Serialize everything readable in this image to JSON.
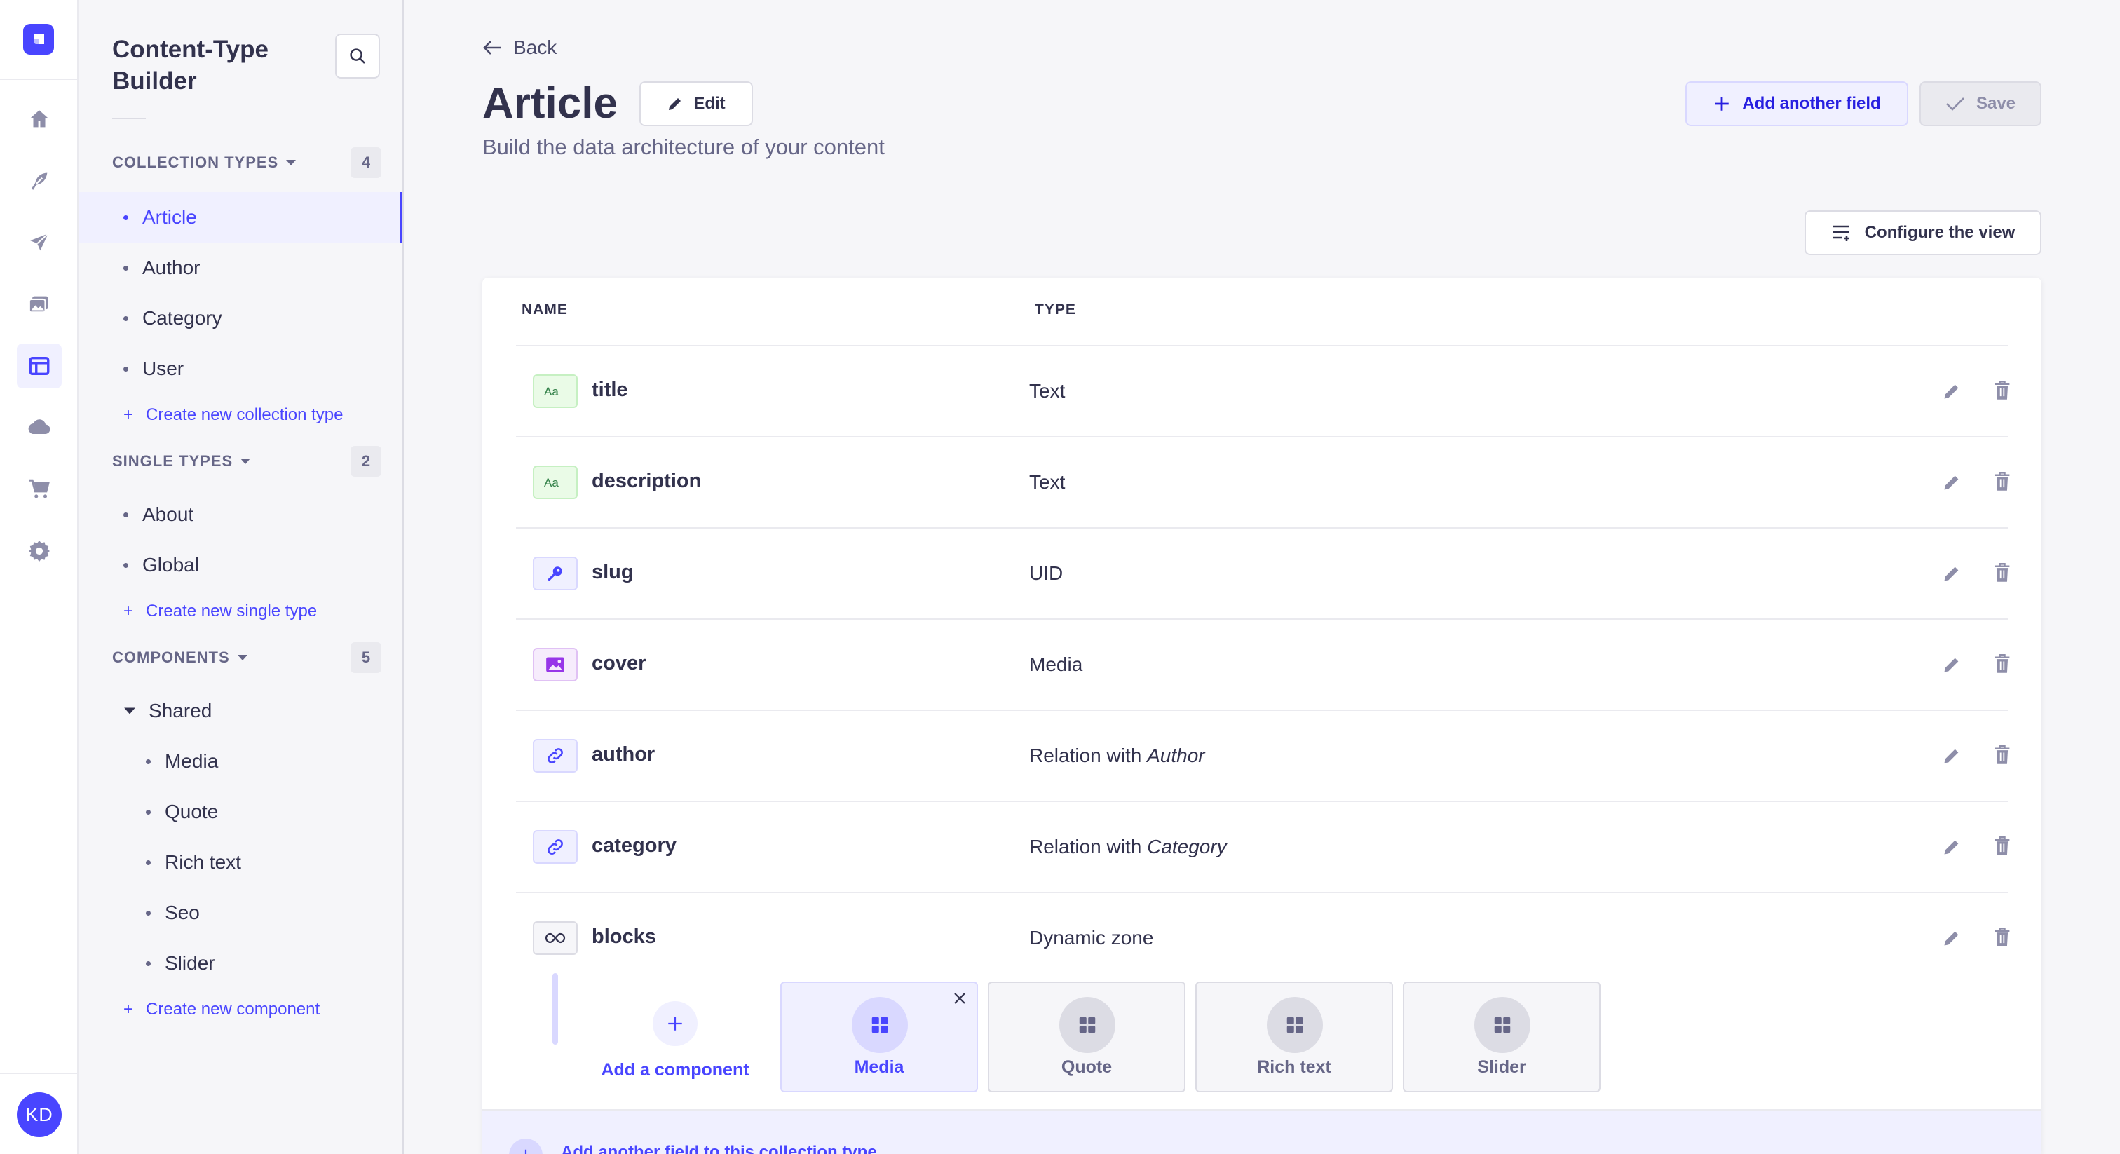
{
  "rail": {
    "logo_icon": "strapi-logo-icon",
    "items": [
      "home-icon",
      "feather-icon",
      "paper-plane-icon",
      "media-library-icon",
      "layout-icon",
      "cloud-icon",
      "cart-icon",
      "gear-icon"
    ],
    "active_item": "layout-icon",
    "avatar_initials": "KD"
  },
  "subnav": {
    "title": "Content-Type Builder",
    "collection_types": {
      "label": "COLLECTION TYPES",
      "count": "4",
      "items": [
        "Article",
        "Author",
        "Category",
        "User"
      ],
      "active": "Article",
      "create_label": "Create new collection type"
    },
    "single_types": {
      "label": "SINGLE TYPES",
      "count": "2",
      "items": [
        "About",
        "Global"
      ],
      "create_label": "Create new single type"
    },
    "components": {
      "label": "COMPONENTS",
      "count": "5",
      "group": "Shared",
      "items": [
        "Media",
        "Quote",
        "Rich text",
        "Seo",
        "Slider"
      ],
      "create_label": "Create new component"
    }
  },
  "header": {
    "back_label": "Back",
    "title": "Article",
    "edit_label": "Edit",
    "subtitle": "Build the data architecture of your content",
    "add_field_label": "Add another field",
    "save_label": "Save",
    "configure_label": "Configure the view"
  },
  "table": {
    "col_name": "NAME",
    "col_type": "TYPE",
    "rows": [
      {
        "icon": "text-icon",
        "name": "title",
        "type": "Text",
        "rel": ""
      },
      {
        "icon": "text-icon",
        "name": "description",
        "type": "Text",
        "rel": ""
      },
      {
        "icon": "uid-key-icon",
        "name": "slug",
        "type": "UID",
        "rel": ""
      },
      {
        "icon": "media-icon",
        "name": "cover",
        "type": "Media",
        "rel": ""
      },
      {
        "icon": "relation-icon",
        "name": "author",
        "type": "Relation with ",
        "rel": "Author"
      },
      {
        "icon": "relation-icon",
        "name": "category",
        "type": "Relation with ",
        "rel": "Category"
      },
      {
        "icon": "dynamic-zone-icon",
        "name": "blocks",
        "type": "Dynamic zone",
        "rel": ""
      }
    ]
  },
  "dynamic_zone": {
    "add_component_label": "Add a component",
    "components": [
      "Media",
      "Quote",
      "Rich text",
      "Slider"
    ],
    "active": "Media"
  },
  "footer": {
    "add_field_label": "Add another field to this collection type"
  },
  "colors": {
    "primary": "#4945ff",
    "primary_light": "#f0f0ff",
    "text": "#32324d",
    "muted": "#666687"
  }
}
